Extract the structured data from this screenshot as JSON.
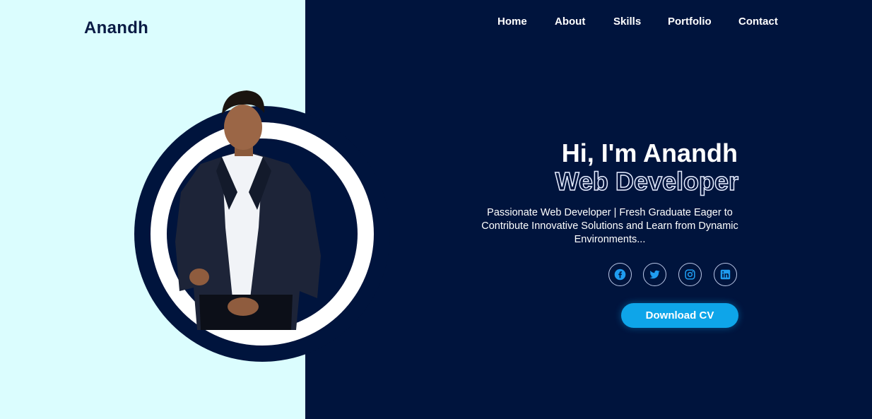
{
  "header": {
    "logo": "Anandh",
    "nav": [
      {
        "label": "Home"
      },
      {
        "label": "About"
      },
      {
        "label": "Skills"
      },
      {
        "label": "Portfolio"
      },
      {
        "label": "Contact"
      }
    ]
  },
  "hero": {
    "greeting": "Hi, I'm Anandh",
    "role": "Web Developer",
    "description": "Passionate Web Developer | Fresh Graduate Eager to Contribute Innovative Solutions and Learn from Dynamic Environments...",
    "cv_button": "Download CV",
    "socials": [
      {
        "icon": "facebook-icon"
      },
      {
        "icon": "twitter-icon"
      },
      {
        "icon": "instagram-icon"
      },
      {
        "icon": "linkedin-icon"
      }
    ],
    "profile_image": "portrait-photo"
  },
  "colors": {
    "left_panel": "#dbfdfe",
    "dark_navy": "#00143d",
    "accent": "#0ea5e9",
    "social_icon": "#1f9cf0"
  }
}
